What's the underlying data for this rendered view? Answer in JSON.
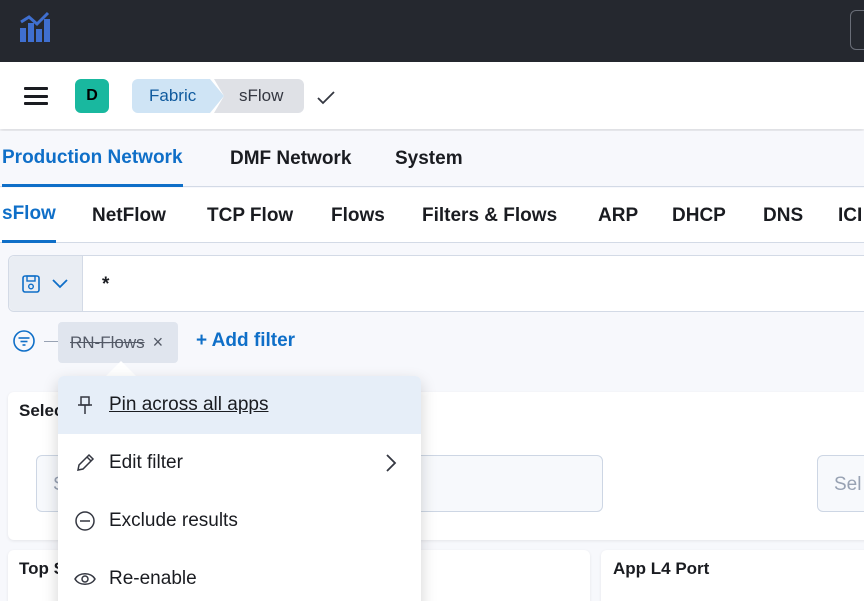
{
  "header": {
    "avatar_letter": "D",
    "breadcrumbs": [
      "Fabric",
      "sFlow"
    ]
  },
  "tabs_primary": [
    "Production Network",
    "DMF Network",
    "System"
  ],
  "tabs_secondary": [
    "sFlow",
    "NetFlow",
    "TCP Flow",
    "Flows",
    "Filters & Flows",
    "ARP",
    "DHCP",
    "DNS",
    "ICI"
  ],
  "query": {
    "value": "*"
  },
  "filters": {
    "pill_label": "RN-Flows",
    "add_filter": "+ Add filter"
  },
  "panels": {
    "select_title": "Selec",
    "left_input_placeholder": "S",
    "right_input_placeholder": "Sel",
    "top_title": "Top S",
    "app_port_title": "App L4 Port"
  },
  "filter_menu": {
    "items": [
      {
        "label": "Pin across all apps",
        "icon": "pin-icon"
      },
      {
        "label": "Edit filter",
        "icon": "pencil-icon"
      },
      {
        "label": "Exclude results",
        "icon": "minus-circle-icon"
      },
      {
        "label": "Re-enable",
        "icon": "eye-icon"
      }
    ]
  },
  "colors": {
    "accent": "#0f6fc8",
    "topbar": "#25282f",
    "avatar": "#19b89f"
  }
}
